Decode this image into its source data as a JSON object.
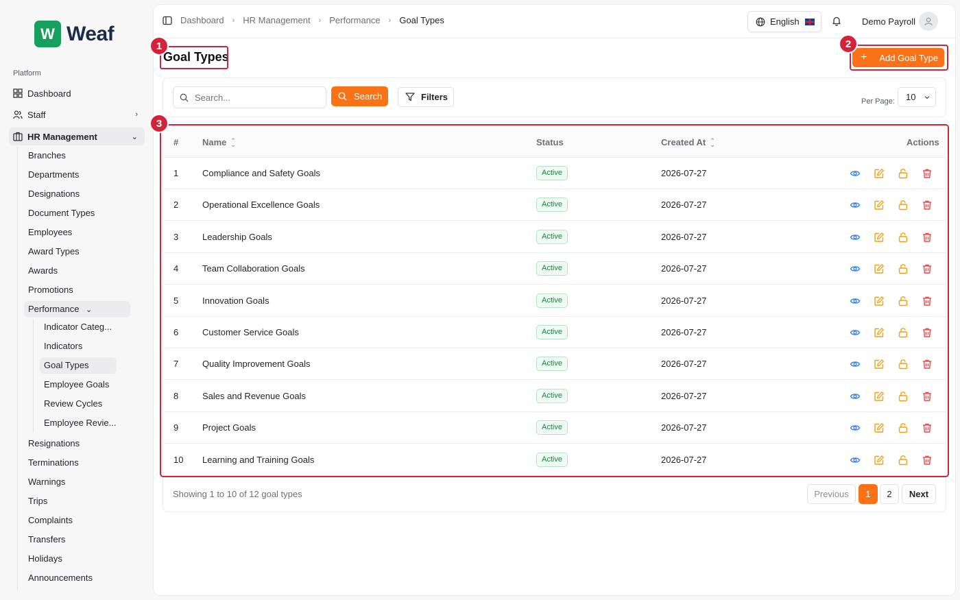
{
  "brand": {
    "mark": "W",
    "name": "Weaf"
  },
  "sidebar": {
    "section_label": "Platform",
    "items": [
      {
        "label": "Dashboard"
      },
      {
        "label": "Staff"
      },
      {
        "label": "HR Management"
      }
    ],
    "hr_sub": [
      "Branches",
      "Departments",
      "Designations",
      "Document Types",
      "Employees",
      "Award Types",
      "Awards",
      "Promotions"
    ],
    "performance_label": "Performance",
    "performance_sub": [
      "Indicator Categ...",
      "Indicators",
      "Goal Types",
      "Employee Goals",
      "Review Cycles",
      "Employee Revie..."
    ],
    "hr_sub_after": [
      "Resignations",
      "Terminations",
      "Warnings",
      "Trips",
      "Complaints",
      "Transfers",
      "Holidays",
      "Announcements"
    ]
  },
  "breadcrumbs": [
    "Dashboard",
    "HR Management",
    "Performance",
    "Goal Types"
  ],
  "header": {
    "language": "English",
    "user_name": "Demo Payroll"
  },
  "page": {
    "title": "Goal Types",
    "add_button": "Add Goal Type"
  },
  "annotations": [
    "1",
    "2",
    "3"
  ],
  "toolbar": {
    "search_placeholder": "Search...",
    "search_button": "Search",
    "filters_button": "Filters",
    "per_page_label": "Per Page:",
    "per_page_value": "10"
  },
  "table": {
    "columns": {
      "index": "#",
      "name": "Name",
      "status": "Status",
      "created": "Created At",
      "actions": "Actions"
    },
    "rows": [
      {
        "n": "1",
        "name": "Compliance and Safety Goals",
        "status": "Active",
        "created": "2026-07-27"
      },
      {
        "n": "2",
        "name": "Operational Excellence Goals",
        "status": "Active",
        "created": "2026-07-27"
      },
      {
        "n": "3",
        "name": "Leadership Goals",
        "status": "Active",
        "created": "2026-07-27"
      },
      {
        "n": "4",
        "name": "Team Collaboration Goals",
        "status": "Active",
        "created": "2026-07-27"
      },
      {
        "n": "5",
        "name": "Innovation Goals",
        "status": "Active",
        "created": "2026-07-27"
      },
      {
        "n": "6",
        "name": "Customer Service Goals",
        "status": "Active",
        "created": "2026-07-27"
      },
      {
        "n": "7",
        "name": "Quality Improvement Goals",
        "status": "Active",
        "created": "2026-07-27"
      },
      {
        "n": "8",
        "name": "Sales and Revenue Goals",
        "status": "Active",
        "created": "2026-07-27"
      },
      {
        "n": "9",
        "name": "Project Goals",
        "status": "Active",
        "created": "2026-07-27"
      },
      {
        "n": "10",
        "name": "Learning and Training Goals",
        "status": "Active",
        "created": "2026-07-27"
      }
    ]
  },
  "pagination": {
    "summary": "Showing 1 to 10 of 12 goal types",
    "previous": "Previous",
    "pages": [
      "1",
      "2"
    ],
    "next": "Next"
  },
  "colors": {
    "accent": "#f97316",
    "brand": "#17a05d",
    "annotation": "#d3233a",
    "view": "#3b82f6",
    "edit": "#f59e0b",
    "delete": "#ef4444"
  }
}
